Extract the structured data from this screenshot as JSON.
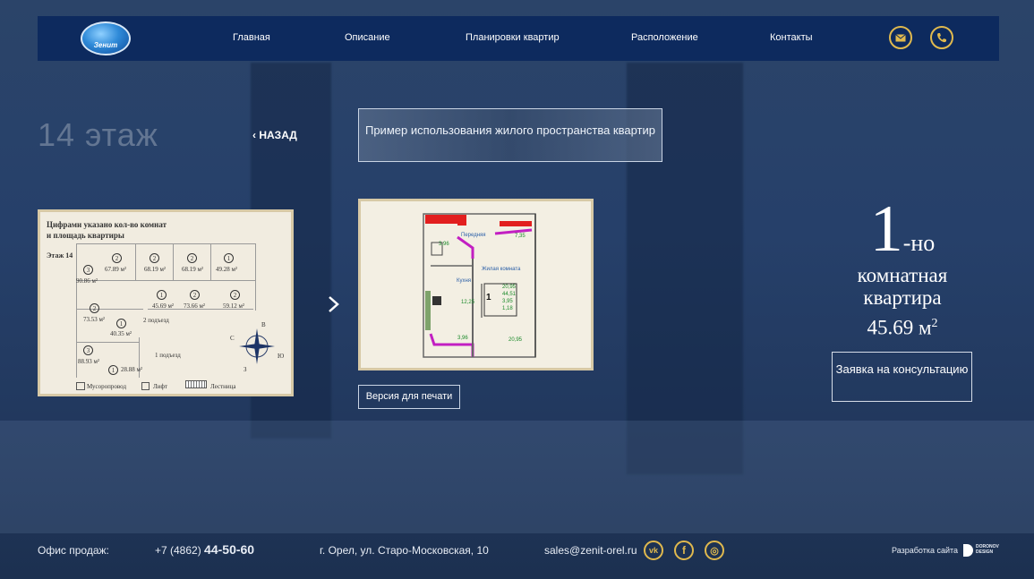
{
  "header": {
    "logo_text": "Зенит",
    "nav": [
      "Главная",
      "Описание",
      "Планировки квартир",
      "Расположение",
      "Контакты"
    ],
    "icons": [
      "mail-icon",
      "phone-icon"
    ],
    "accent_color": "#e0b94e",
    "bar_color": "#0d2a5e"
  },
  "page": {
    "floor_title": "14 этаж",
    "back_label": "НАЗАД",
    "example_button": "Пример использования жилого пространства квартир",
    "print_button": "Версия для печати",
    "consult_button": "Заявка на консультацию",
    "apartment": {
      "rooms": "1",
      "rooms_suffix": "-но",
      "line1": "комнатная",
      "line2": "квартира",
      "area": "45.69 м",
      "area_sup": "2"
    }
  },
  "floor_plan": {
    "title_line1": "Цифрами указано кол-во комнат",
    "title_line2": "и площадь квартиры",
    "floor_label": "Этаж 14",
    "apartments": [
      {
        "rooms": "2",
        "area": "67.89 м²"
      },
      {
        "rooms": "2",
        "area": "68.19 м²"
      },
      {
        "rooms": "2",
        "area": "68.19 м²"
      },
      {
        "rooms": "1",
        "area": "49.28 м²"
      },
      {
        "rooms": "3",
        "area": "90.86 м²"
      },
      {
        "rooms": "1",
        "area": "45.69 м²"
      },
      {
        "rooms": "2",
        "area": "73.66 м²"
      },
      {
        "rooms": "2",
        "area": "59.12 м²"
      },
      {
        "rooms": "2",
        "area": "73.53 м²"
      },
      {
        "rooms": "1",
        "area": "40.35 м²"
      },
      {
        "rooms": "3",
        "area": "88.93 м²"
      },
      {
        "rooms": "1",
        "area": "28.88 м²"
      }
    ],
    "entrance2": "2 подъезд",
    "entrance1": "1 подъезд",
    "legend": [
      "Мусоропровод",
      "Лифт",
      "Лестница"
    ],
    "compass": [
      "С",
      "В",
      "Ю",
      "З"
    ]
  },
  "apt_plan": {
    "rooms": [
      "Передняя",
      "Жилая комната",
      "Кухня"
    ],
    "areas": [
      "20,95",
      "44,51",
      "3,95",
      "1,18"
    ],
    "room_count": "1",
    "dims": [
      "7,35",
      "3,96",
      "12,25",
      "3,96",
      "20,95"
    ]
  },
  "footer": {
    "office_label": "Офис продаж:",
    "phone_prefix": "+7 (4862)",
    "phone_main": "44-50-60",
    "address": "г. Орел, ул. Старо-Московская, 10",
    "email": "sales@zenit-orel.ru",
    "social": [
      "vk-icon",
      "facebook-icon",
      "instagram-icon"
    ],
    "social_labels": [
      "vk",
      "f",
      "◎"
    ],
    "dev_label": "Разработка сайта",
    "dev_brand": "DORONOV DESIGN"
  }
}
